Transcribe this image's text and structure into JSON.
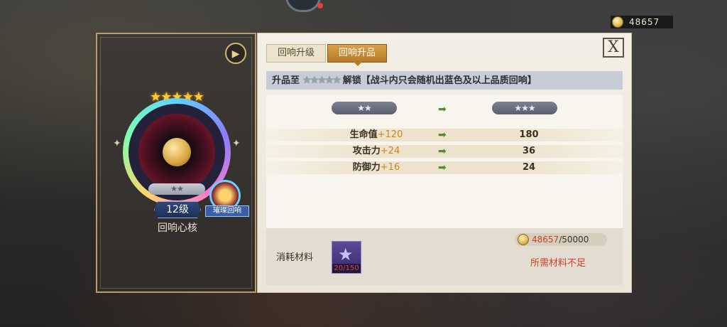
{
  "currency": {
    "amount": "48657"
  },
  "item": {
    "name": "回响心核",
    "level": "12级",
    "rank_stars": "★★",
    "top_stars": "★★★★★",
    "sub_tag": "璀璨回响"
  },
  "tabs": {
    "upgrade": "回响升级",
    "promote": "回响升品"
  },
  "unlock": {
    "prefix": "升品至",
    "stars": "★★★★★",
    "text": "解锁【战斗内只会随机出蓝色及以上品质回响】"
  },
  "promotion": {
    "from_stars": "★★",
    "to_stars": "★★★",
    "stats": [
      {
        "label": "生命值",
        "bonus": "+120",
        "new": "180"
      },
      {
        "label": "攻击力",
        "bonus": "+24",
        "new": "36"
      },
      {
        "label": "防御力",
        "bonus": "+16",
        "new": "24"
      }
    ]
  },
  "materials": {
    "label": "消耗材料",
    "item_count": "20/150",
    "cost_have": "48657",
    "cost_need": "/50000",
    "status": "所需材料不足"
  },
  "colors": {
    "accent": "#d9a24a",
    "warning": "#d83a2a",
    "plus": "#c98a1a"
  }
}
